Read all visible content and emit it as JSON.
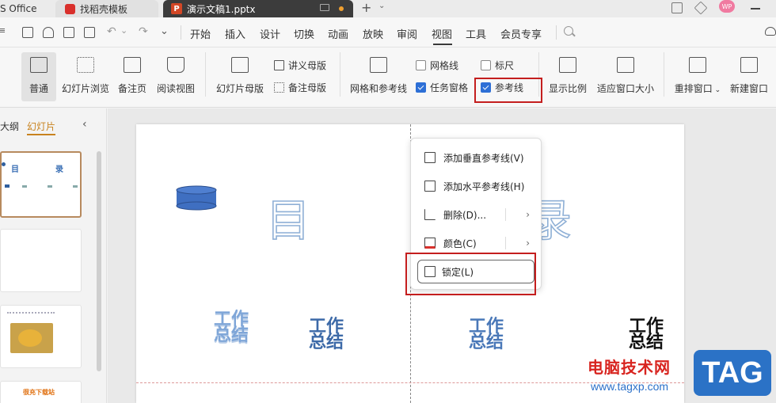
{
  "titlebar": {
    "tabs": [
      {
        "label": "S Office"
      },
      {
        "label": "找稻壳模板"
      },
      {
        "label": "演示文稿1.pptx",
        "badge": "P"
      }
    ],
    "new_tab": "+",
    "avatar": "WP"
  },
  "menu": {
    "items": [
      "开始",
      "插入",
      "设计",
      "切换",
      "动画",
      "放映",
      "审阅",
      "视图",
      "工具",
      "会员专享"
    ],
    "active": "视图"
  },
  "ribbon": {
    "normal": "普通",
    "slide_sorter": "幻灯片浏览",
    "notes_page": "备注页",
    "reading_view": "阅读视图",
    "slide_master": "幻灯片母版",
    "handout_master": "讲义母版",
    "notes_master": "备注母版",
    "grid_and_guides": "网格和参考线",
    "gridlines": {
      "label": "网格线",
      "checked": false
    },
    "task_pane": {
      "label": "任务窗格",
      "checked": true
    },
    "ruler": {
      "label": "标尺",
      "checked": false
    },
    "guides": {
      "label": "参考线",
      "checked": true
    },
    "zoom": "显示比例",
    "fit_window": "适应窗口大小",
    "arrange": "重排窗口",
    "new_window": "新建窗口"
  },
  "left_panel": {
    "tab_outline": "大纲",
    "tab_slides": "幻灯片",
    "thumb1": {
      "title_a": "目",
      "title_b": "录"
    },
    "thumb5_text": "很充下载站"
  },
  "slide": {
    "title_left": "目",
    "title_right": "录",
    "wordart": [
      "工作\n总结",
      "工作\n总结",
      "工作\n总结",
      "工作\n总结"
    ]
  },
  "context_menu": {
    "add_vertical": "添加垂直参考线(V)",
    "add_horizontal": "添加水平参考线(H)",
    "delete": "删除(D)...",
    "color": "颜色(C)",
    "lock": "锁定(L)"
  },
  "watermark": {
    "text": "电脑技术网",
    "url": "www.tagxp.com",
    "tag": "TAG"
  },
  "colors": {
    "accent": "#c8821e",
    "highlight_box": "#c41e1e",
    "checkbox_on": "#2d6fd6",
    "wordart_blue": "#2f5f9e"
  }
}
